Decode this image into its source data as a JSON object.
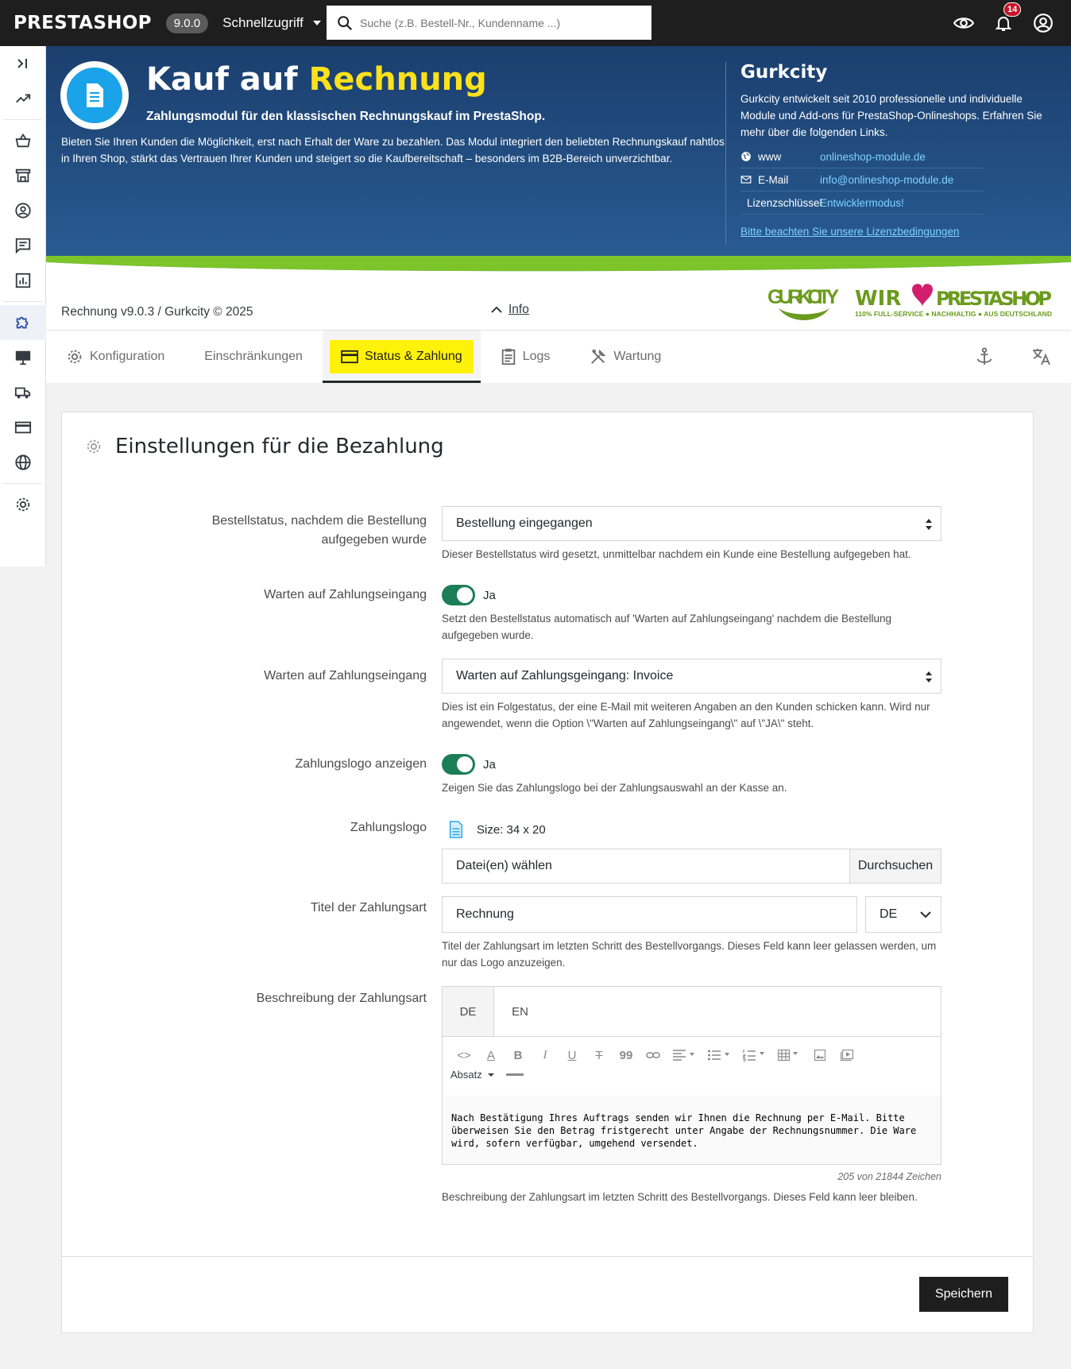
{
  "topbar": {
    "logo": "PRESTASHOP",
    "version": "9.0.0",
    "quick_access": "Schnellzugriff",
    "search_placeholder": "Suche (z.B. Bestell-Nr., Kundenname ...)",
    "notifications": "14"
  },
  "header": {
    "title_prefix": "Kauf auf",
    "title_highlight": "Rechnung",
    "subtitle": "Zahlungsmodul für den klassischen Rechnungskauf im PrestaShop.",
    "description": "Bieten Sie Ihren Kunden die Möglichkeit, erst nach Erhalt der Ware zu bezahlen. Das Modul integriert den beliebten Rechnungskauf nahtlos in Ihren Shop, stärkt das Vertrauen Ihrer Kunden und steigert so die Kaufbereitschaft – besonders im B2B-Bereich unverzichtbar.",
    "vendor": {
      "name": "Gurkcity",
      "text": "Gurkcity entwickelt seit 2010 professionelle und individuelle Module und Add-ons für PrestaShop-Onlineshops. Erfahren Sie mehr über die folgenden Links.",
      "links": [
        {
          "label": "www",
          "value": "onlineshop-module.de"
        },
        {
          "label": "E-Mail",
          "value": "info@onlineshop-module.de"
        },
        {
          "label": "Lizenzschlüssel",
          "value": "Entwicklermodus!"
        }
      ],
      "license_link": "Bitte beachten Sie unsere Lizenzbedingungen"
    }
  },
  "infobar": {
    "version_text": "Rechnung v9.0.3 / Gurkcity © 2025",
    "info_label": "Info",
    "logo_gurk": "GURKCITY",
    "logo_wir": "WIR",
    "logo_presta": "PRESTASHOP",
    "logo_tagline": "110% FULL-SERVICE ● NACHHALTIG ● AUS DEUTSCHLAND"
  },
  "tabs": [
    {
      "label": "Konfiguration"
    },
    {
      "label": "Einschränkungen"
    },
    {
      "label": "Status & Zahlung"
    },
    {
      "label": "Logs"
    },
    {
      "label": "Wartung"
    }
  ],
  "panel": {
    "title": "Einstellungen für die Bezahlung",
    "fields": {
      "order_status": {
        "label": "Bestellstatus, nachdem die Bestellung aufgegeben wurde",
        "value": "Bestellung eingegangen",
        "help": "Dieser Bestellstatus wird gesetzt, unmittelbar nachdem ein Kunde eine Bestellung aufgegeben hat."
      },
      "wait_toggle": {
        "label": "Warten auf Zahlungseingang",
        "value": "Ja",
        "help": "Setzt den Bestellstatus automatisch auf 'Warten auf Zahlungseingang' nachdem die Bestellung aufgegeben wurde."
      },
      "wait_status": {
        "label": "Warten auf Zahlungseingang",
        "value": "Warten auf Zahlungsgeingang: Invoice",
        "help": "Dies ist ein Folgestatus, der eine E-Mail mit weiteren Angaben an den Kunden schicken kann. Wird nur angewendet, wenn die Option \\\"Warten auf Zahlungseingang\\\" auf \\\"JA\\\" steht."
      },
      "logo_toggle": {
        "label": "Zahlungslogo anzeigen",
        "value": "Ja",
        "help": "Zeigen Sie das Zahlungslogo bei der Zahlungsauswahl an der Kasse an."
      },
      "logo_file": {
        "label": "Zahlungslogo",
        "size": "Size: 34 x 20",
        "placeholder": "Datei(en) wählen",
        "browse": "Durchsuchen"
      },
      "title": {
        "label": "Titel der Zahlungsart",
        "value": "Rechnung",
        "lang": "DE",
        "help": "Titel der Zahlungsart im letzten Schritt des Bestellvorgangs. Dieses Feld kann leer gelassen werden, um nur das Logo anzuzeigen."
      },
      "description": {
        "label": "Beschreibung der Zahlungsart",
        "langs": [
          "DE",
          "EN"
        ],
        "format": "Absatz",
        "text": "Nach Bestätigung Ihres Auftrags senden wir Ihnen die Rechnung per E-Mail. Bitte überweisen Sie den Betrag fristgerecht unter Angabe der Rechnungsnummer. Die Ware wird, sofern verfügbar, umgehend versendet.",
        "counter": "205 von 21844 Zeichen",
        "help": "Beschreibung der Zahlungsart im letzten Schritt des Bestellvorgangs. Dieses Feld kann leer bleiben."
      }
    },
    "save": "Speichern"
  }
}
